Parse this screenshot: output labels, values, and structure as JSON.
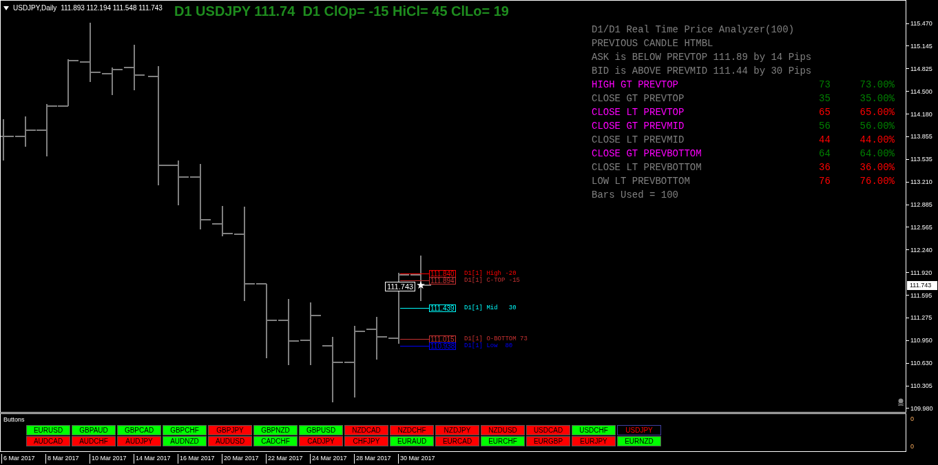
{
  "chart_header": {
    "symbol": "USDJPY,Daily",
    "quotes": "111.893 112.194 111.548 111.743"
  },
  "headline": "D1 USDJPY 111.74  D1 ClOp= -15 HiCl= 45 ClLo= 19",
  "analyzer": {
    "title": "D1/D1 Real Time Price Analyzer(100)",
    "subtitle": "PREVIOUS CANDLE HTMBL",
    "ask_line": "ASK is BELOW PREVTOP 111.89 by 14 Pips",
    "bid_line": "BID is ABOVE PREVMID 111.44 by 30 Pips",
    "rows": [
      {
        "label": "HIGH GT PREVTOP",
        "highlight": true,
        "count": "73",
        "percent": "73.00%",
        "color": "#008000"
      },
      {
        "label": "CLOSE GT PREVTOP",
        "highlight": false,
        "count": "35",
        "percent": "35.00%",
        "color": "#008000"
      },
      {
        "label": "CLOSE LT PREVTOP",
        "highlight": true,
        "count": "65",
        "percent": "65.00%",
        "color": "#ff0000"
      },
      {
        "label": "CLOSE GT PREVMID",
        "highlight": true,
        "count": "56",
        "percent": "56.00%",
        "color": "#008000"
      },
      {
        "label": "CLOSE LT PREVMID",
        "highlight": false,
        "count": "44",
        "percent": "44.00%",
        "color": "#ff0000"
      },
      {
        "label": "CLOSE GT PREVBOTTOM",
        "highlight": true,
        "count": "64",
        "percent": "64.00%",
        "color": "#008000"
      },
      {
        "label": "CLOSE LT PREVBOTTOM",
        "highlight": false,
        "count": "36",
        "percent": "36.00%",
        "color": "#ff0000"
      },
      {
        "label": "LOW LT PREVBOTTOM",
        "highlight": false,
        "count": "76",
        "percent": "76.00%",
        "color": "#ff0000"
      }
    ],
    "footer": "Bars Used = 100"
  },
  "levels": [
    {
      "price": "111.840",
      "label": "D1[1] High -20",
      "color": "#ff0000"
    },
    {
      "price": "111.894",
      "label": "D1[1] C-TOP -15",
      "color": "#c83232"
    },
    {
      "price": "111.439",
      "label": "D1[1] Mid   30",
      "color": "#00ffff"
    },
    {
      "price": "111.015",
      "label": "D1[1] O-BOTTOM 73",
      "color": "#c83232"
    },
    {
      "price": "110.938",
      "label": "D1[1] Low  80",
      "color": "#0000ff"
    }
  ],
  "current_price_label": "111.743",
  "price_axis": {
    "ticks": [
      "115.470",
      "115.145",
      "114.825",
      "114.500",
      "114.180",
      "113.855",
      "113.535",
      "113.210",
      "112.885",
      "112.565",
      "112.240",
      "111.920",
      "111.595",
      "111.275",
      "110.950",
      "110.630",
      "110.305",
      "109.980"
    ],
    "current": "111.743"
  },
  "buttons_window": {
    "title": "Buttons",
    "axis": [
      "0",
      "0"
    ],
    "buttons": [
      {
        "label": "EURUSD",
        "color": "#00ff00",
        "selected": false
      },
      {
        "label": "GBPAUD",
        "color": "#00ff00",
        "selected": false
      },
      {
        "label": "GBPCAD",
        "color": "#00ff00",
        "selected": false
      },
      {
        "label": "GBPCHF",
        "color": "#00ff00",
        "selected": false
      },
      {
        "label": "GBPJPY",
        "color": "#ff0000",
        "selected": false
      },
      {
        "label": "GBPNZD",
        "color": "#00ff00",
        "selected": false
      },
      {
        "label": "GBPUSD",
        "color": "#00ff00",
        "selected": false
      },
      {
        "label": "NZDCAD",
        "color": "#ff0000",
        "selected": false
      },
      {
        "label": "NZDCHF",
        "color": "#ff0000",
        "selected": false
      },
      {
        "label": "NZDJPY",
        "color": "#ff0000",
        "selected": false
      },
      {
        "label": "NZDUSD",
        "color": "#ff0000",
        "selected": false
      },
      {
        "label": "USDCAD",
        "color": "#ff0000",
        "selected": false
      },
      {
        "label": "USDCHF",
        "color": "#00ff00",
        "selected": false
      },
      {
        "label": "USDJPY",
        "color": "#000000",
        "selected": true
      },
      {
        "label": "AUDCAD",
        "color": "#ff0000",
        "selected": false
      },
      {
        "label": "AUDCHF",
        "color": "#ff0000",
        "selected": false
      },
      {
        "label": "AUDJPY",
        "color": "#ff0000",
        "selected": false
      },
      {
        "label": "AUDNZD",
        "color": "#00ff00",
        "selected": false
      },
      {
        "label": "AUDUSD",
        "color": "#ff0000",
        "selected": false
      },
      {
        "label": "CADCHF",
        "color": "#00ff00",
        "selected": false
      },
      {
        "label": "CADJPY",
        "color": "#ff0000",
        "selected": false
      },
      {
        "label": "CHFJPY",
        "color": "#ff0000",
        "selected": false
      },
      {
        "label": "EURAUD",
        "color": "#00ff00",
        "selected": false
      },
      {
        "label": "EURCAD",
        "color": "#ff0000",
        "selected": false
      },
      {
        "label": "EURCHF",
        "color": "#00ff00",
        "selected": false
      },
      {
        "label": "EURGBP",
        "color": "#ff0000",
        "selected": false
      },
      {
        "label": "EURJPY",
        "color": "#ff0000",
        "selected": false
      },
      {
        "label": "EURNZD",
        "color": "#00ff00",
        "selected": false
      }
    ]
  },
  "date_axis": [
    "6 Mar 2017",
    "8 Mar 2017",
    "10 Mar 2017",
    "14 Mar 2017",
    "16 Mar 2017",
    "20 Mar 2017",
    "22 Mar 2017",
    "24 Mar 2017",
    "28 Mar 2017",
    "30 Mar 2017"
  ]
}
